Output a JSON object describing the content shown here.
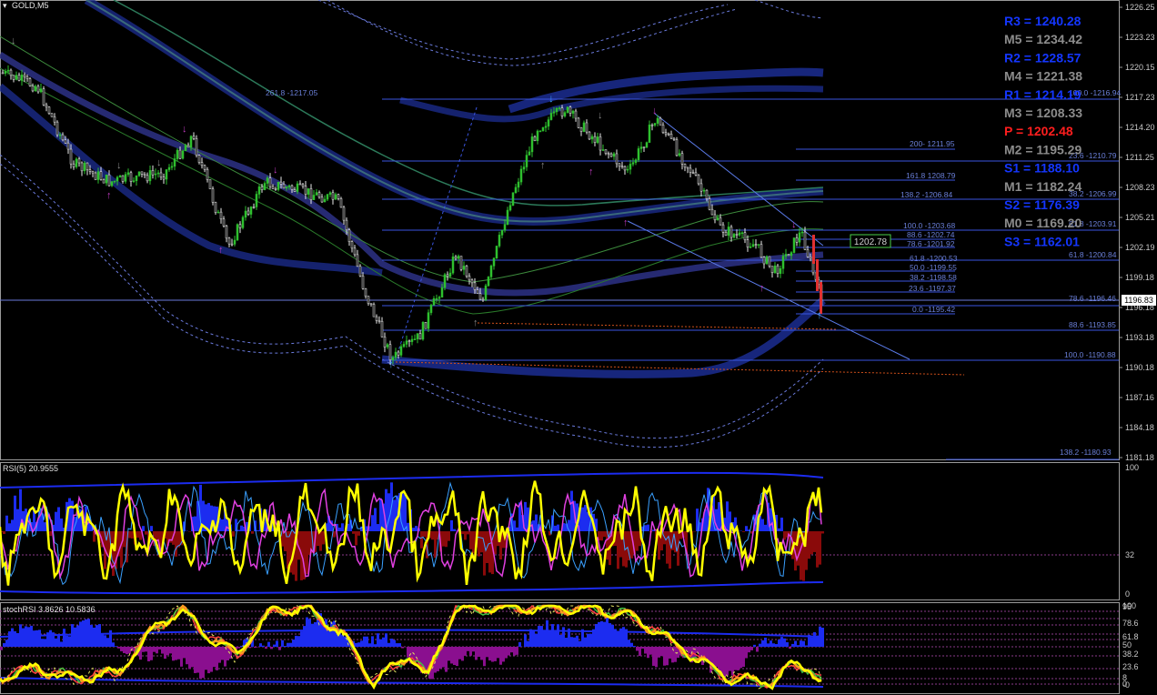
{
  "window": {
    "title": "GOLD,M5"
  },
  "colors": {
    "background": "#000000",
    "fib": "#3a55e0",
    "pivot_r_s": "#1436ff",
    "pivot_m": "#8c8c8c",
    "pivot_p": "#ff1e1e",
    "rsi_line": "#ffff00",
    "hist_up": "#1c2cf0",
    "hist_down_rsi": "#8a0a0a",
    "hist_down_stoch": "#8a0f8f"
  },
  "price_axis": {
    "ticks": [
      "1226.25",
      "1223.23",
      "1220.15",
      "1217.23",
      "1214.20",
      "1211.25",
      "1208.23",
      "1205.21",
      "1202.19",
      "1199.18",
      "1196.18",
      "1193.18",
      "1190.18",
      "1187.16",
      "1184.18",
      "1181.18"
    ],
    "current_price": "1196.83"
  },
  "pivots": [
    {
      "text": "R3 = 1240.28",
      "kind": "rs"
    },
    {
      "text": "M5 = 1234.42",
      "kind": "m"
    },
    {
      "text": "R2 = 1228.57",
      "kind": "rs"
    },
    {
      "text": "M4 = 1221.38",
      "kind": "m"
    },
    {
      "text": "R1 = 1214.19",
      "kind": "rs"
    },
    {
      "text": "M3 = 1208.33",
      "kind": "m"
    },
    {
      "text": "P  = 1202.48",
      "kind": "p"
    },
    {
      "text": "M2 = 1195.29",
      "kind": "m"
    },
    {
      "text": "S1 = 1188.10",
      "kind": "rs"
    },
    {
      "text": "M1 = 1182.24",
      "kind": "m"
    },
    {
      "text": "S2 = 1176.39",
      "kind": "rs"
    },
    {
      "text": "M0 = 1169.20",
      "kind": "m"
    },
    {
      "text": "S3 = 1162.01",
      "kind": "rs"
    }
  ],
  "fib_labels": [
    "261.8 -1217.05",
    "100.0 -1216.94",
    "200- 1211.95",
    "23.6 -1210.79",
    "161.8 1208.79",
    "138.2 -1206.84",
    "38.2 -1206.99",
    "100.0 -1203.68",
    "61.8 -1203.91",
    "88.6 -1202.74",
    "78.6 -1201.92",
    "61.8 -1200.53",
    "61.8 -1200.84",
    "50.0 -1199.55",
    "38.2 -1198.58",
    "23.6 -1197.37",
    "78.6 -1196.46",
    "0.0 -1195.42",
    "88.6 -1193.85",
    "100.0 -1190.88",
    "138.2 -1180.93"
  ],
  "price_box": {
    "text": "1202.78"
  },
  "rsi_panel": {
    "label": "RSI(5) 20.9555",
    "scale": [
      "100",
      "32",
      "0"
    ]
  },
  "stoch_panel": {
    "label": "stochRSI 3.8626 10.5836",
    "scale": [
      "100",
      "95",
      "78.6",
      "61.8",
      "50",
      "38.2",
      "23.6",
      "8",
      "0",
      "-0"
    ]
  }
}
